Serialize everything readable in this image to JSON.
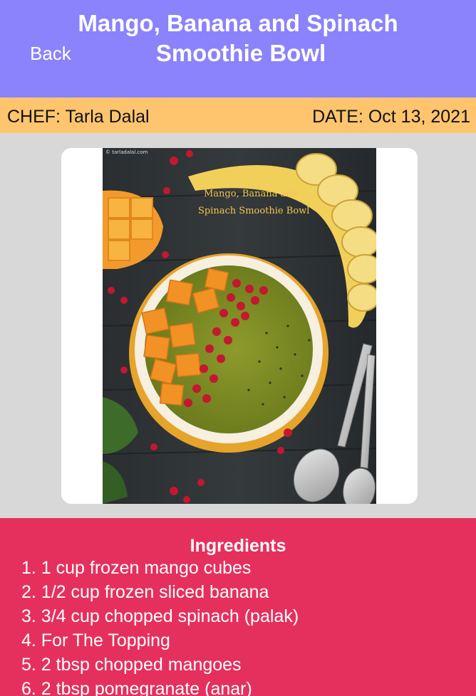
{
  "header": {
    "back_label": "Back",
    "title_line1": "Mango, Banana and Spinach",
    "title_line2": "Smoothie Bowl",
    "background": "#8a83fb"
  },
  "meta": {
    "chef": "CHEF: Tarla Dalal",
    "date": "DATE: Oct 13, 2021",
    "background": "#ffc56e"
  },
  "photo": {
    "watermark": "© tarladalal.com",
    "caption_line1": "Mango, Banana and",
    "caption_line2": "Spinach Smoothie Bowl"
  },
  "ingredients": {
    "title": "Ingredients",
    "background": "#e5305e",
    "items": [
      "1. 1 cup frozen mango cubes",
      "2. 1/2 cup frozen sliced banana",
      "3. 3/4 cup chopped spinach (palak)",
      "4. For The Topping",
      "5. 2 tbsp chopped mangoes",
      "6. 2 tbsp pomegranate (anar)"
    ]
  }
}
